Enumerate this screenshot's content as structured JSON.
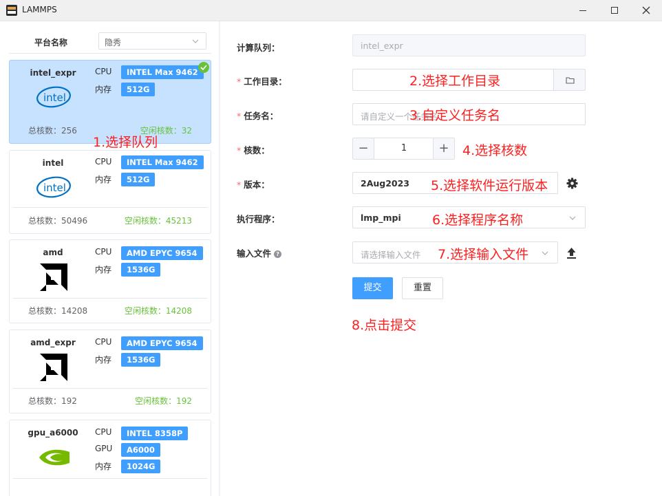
{
  "window": {
    "title": "LAMMPS"
  },
  "colors": {
    "accent": "#409eff",
    "free": "#67c23a",
    "required": "#f56c6c",
    "annotation": "#ff1f1f",
    "selected_bg": "#c6e2ff"
  },
  "sidebar": {
    "platform_label": "平台名称",
    "platform_value": "隐秀",
    "queues": [
      {
        "name": "intel_expr",
        "logo": "intel-logo",
        "selected": true,
        "specs": [
          {
            "key": "CPU",
            "value": "INTEL Max 9462"
          },
          {
            "key": "内存",
            "value": "512G"
          }
        ],
        "total_label": "总核数：256",
        "free_label": "空闲核数：32"
      },
      {
        "name": "intel",
        "logo": "intel-logo",
        "selected": false,
        "specs": [
          {
            "key": "CPU",
            "value": "INTEL Max 9462"
          },
          {
            "key": "内存",
            "value": "512G"
          }
        ],
        "total_label": "总核数：50496",
        "free_label": "空闲核数：45213"
      },
      {
        "name": "amd",
        "logo": "amd-logo",
        "selected": false,
        "specs": [
          {
            "key": "CPU",
            "value": "AMD EPYC 9654"
          },
          {
            "key": "内存",
            "value": "1536G"
          }
        ],
        "total_label": "总核数：14208",
        "free_label": "空闲核数：14208"
      },
      {
        "name": "amd_expr",
        "logo": "amd-logo",
        "selected": false,
        "specs": [
          {
            "key": "CPU",
            "value": "AMD EPYC 9654"
          },
          {
            "key": "内存",
            "value": "1536G"
          }
        ],
        "total_label": "总核数：192",
        "free_label": "空闲核数：192"
      },
      {
        "name": "gpu_a6000",
        "logo": "nvidia-logo",
        "selected": false,
        "specs": [
          {
            "key": "CPU",
            "value": "INTEL 8358P"
          },
          {
            "key": "GPU",
            "value": "A6000"
          },
          {
            "key": "内存",
            "value": "1024G"
          }
        ],
        "total_label": "",
        "free_label": ""
      }
    ]
  },
  "form": {
    "queue": {
      "label": "计算队列：",
      "value": "intel_expr"
    },
    "workdir": {
      "label": "工作目录：",
      "value": ""
    },
    "jobname": {
      "label": "任务名：",
      "placeholder": "请自定义一个任务名"
    },
    "cores": {
      "label": "核数：",
      "value": "1",
      "minus": "−",
      "plus": "+"
    },
    "version": {
      "label": "版本：",
      "value": "2Aug2023"
    },
    "program": {
      "label": "执行程序：",
      "value": "lmp_mpi"
    },
    "inputfile": {
      "label": "输入文件",
      "help": "?",
      "placeholder": "请选择输入文件"
    },
    "submit_label": "提交",
    "reset_label": "重置"
  },
  "annotations": {
    "a1": "1.选择队列",
    "a2": "2.选择工作目录",
    "a3": "3.自定义任务名",
    "a4": "4.选择核数",
    "a5": "5.选择软件运行版本",
    "a6": "6.选择程序名称",
    "a7": "7.选择输入文件",
    "a8": "8.点击提交"
  }
}
